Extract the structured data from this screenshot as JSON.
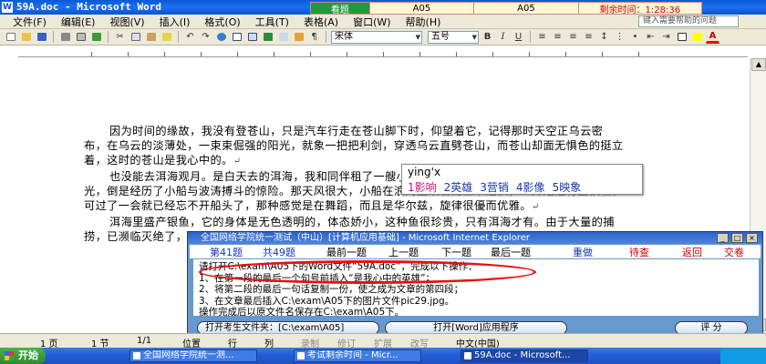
{
  "word": {
    "title": "59A.doc - Microsoft Word",
    "app_icon_letter": "W"
  },
  "exam_strip": {
    "watch": "看题",
    "path1": "A05",
    "path2": "A05",
    "time_left": "剩余时间：1:28:36"
  },
  "menu": {
    "items": [
      "文件(F)",
      "编辑(E)",
      "视图(V)",
      "插入(I)",
      "格式(O)",
      "工具(T)",
      "表格(A)",
      "窗口(W)",
      "帮助(H)"
    ],
    "help_placeholder": "键入需要帮助的问题"
  },
  "toolbar": {
    "font": "宋体",
    "size": "五号",
    "bold": "B",
    "italic": "I",
    "underline": "U",
    "font_color_letter": "A"
  },
  "document": {
    "paragraphs": [
      "因为时间的缘故，我没有登苍山，只是汽车行走在苍山脚下时，仰望着它，记得那时天空正乌云密布，在乌云的淡薄处，一束束倔强的阳光，就象一把把利剑，穿透乌云直劈苍山，而苍山却面无惧色的挺立着，这时的苍山是我心中的。",
      "也没能去洱海观月。是白天去的洱海，我和同伴租了一艘小船，在洱海上，没能领略洱海融融的湖光，倒是经历了小船与波涛搏斗的惊险。那天风很大，小船在浪涛里跌宕而上下起伏，一开始还有些惧怕，可过了一会就已经忘不开船头了，那种感觉是在舞蹈，而且是华尔兹，旋律很優而优雅。",
      "洱海里盛产银鱼，它的身体是无色透明的，体态娇小，这种鱼很珍贵，只有洱海才有。由于大量的捕捞，已濒临灭绝了，现在政府已经禁止捕捞，所以，这种鱼就越发显得珍贵，就越是想挂在嘴上了。"
    ],
    "para_mark": "↵"
  },
  "ime": {
    "pinyin": "ying'x",
    "candidates": [
      "1影响",
      "2英雄",
      "3营销",
      "4影像",
      "5映象"
    ]
  },
  "exam": {
    "title": "全国网络学院统一测试（中山）[计算机应用基础] - Microsoft Internet Explorer",
    "question_no": "第41题",
    "question_total": "共49题",
    "nav": [
      "最前一题",
      "上一题",
      "下一题",
      "最后一题",
      "重做",
      "待查",
      "返回",
      "交卷"
    ],
    "instructions": [
      "请打开C:\\exam\\A05下的Word文件“59A.doc”，完成以下操作：",
      "1、在第一段的最后一个句号前插入“是我心中的英雄”；",
      "2、将第二段的最后一句话复制一份，使之成为文章的第四段；",
      "3、在文章最后插入C:\\exam\\A05下的图片文件pic29.jpg。",
      "操作完成后以原文件名保存在C:\\exam\\A05下。"
    ],
    "open_folder": "打开考生文件夹：[C:\\exam\\A05]",
    "open_word": "打开[Word]应用程序",
    "score": "评 分"
  },
  "status": {
    "page": "1 页",
    "section": "1 节",
    "page_of": "1/1",
    "position": "位置",
    "ln": "行",
    "col": "列",
    "rec": "录制",
    "rev": "修订",
    "ext": "扩展",
    "ovr": "改写",
    "lang": "中文(中国)"
  },
  "taskbar": {
    "start": "开始",
    "tasks": [
      "全国网络学院统一测...",
      "考试剩余时间 - Micr...",
      "59A.doc - Microsoft..."
    ]
  },
  "colors": {
    "title_blue": "#1d6ff0",
    "exam_bg": "#6699cc",
    "red_mark": "#e81010",
    "timer_red": "#cc0000"
  }
}
